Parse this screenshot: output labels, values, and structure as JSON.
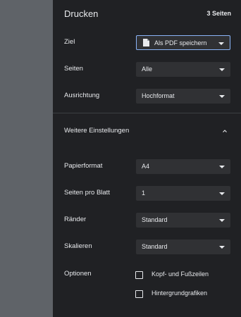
{
  "header": {
    "title": "Drucken",
    "page_count": "3 Seiten"
  },
  "settings": [
    {
      "label": "Ziel",
      "value": "Als PDF speichern",
      "icon": "file-icon"
    },
    {
      "label": "Seiten",
      "value": "Alle"
    },
    {
      "label": "Ausrichtung",
      "value": "Hochformat"
    }
  ],
  "more_settings": {
    "label": "Weitere Einstellungen",
    "icon": "chevron-up-icon"
  },
  "advanced": [
    {
      "label": "Papierformat",
      "value": "A4"
    },
    {
      "label": "Seiten pro Blatt",
      "value": "1"
    },
    {
      "label": "Ränder",
      "value": "Standard"
    },
    {
      "label": "Skalieren",
      "value": "Standard"
    }
  ],
  "options": {
    "label": "Optionen",
    "items": [
      {
        "label": "Kopf- und Fußzeilen",
        "checked": false
      },
      {
        "label": "Hintergrundgrafiken",
        "checked": false
      }
    ]
  },
  "colors": {
    "panel_bg": "#202124",
    "preview_bg": "#5f6368",
    "select_bg": "#303134",
    "focus": "#8ab4f8",
    "text": "#e8eaed"
  }
}
